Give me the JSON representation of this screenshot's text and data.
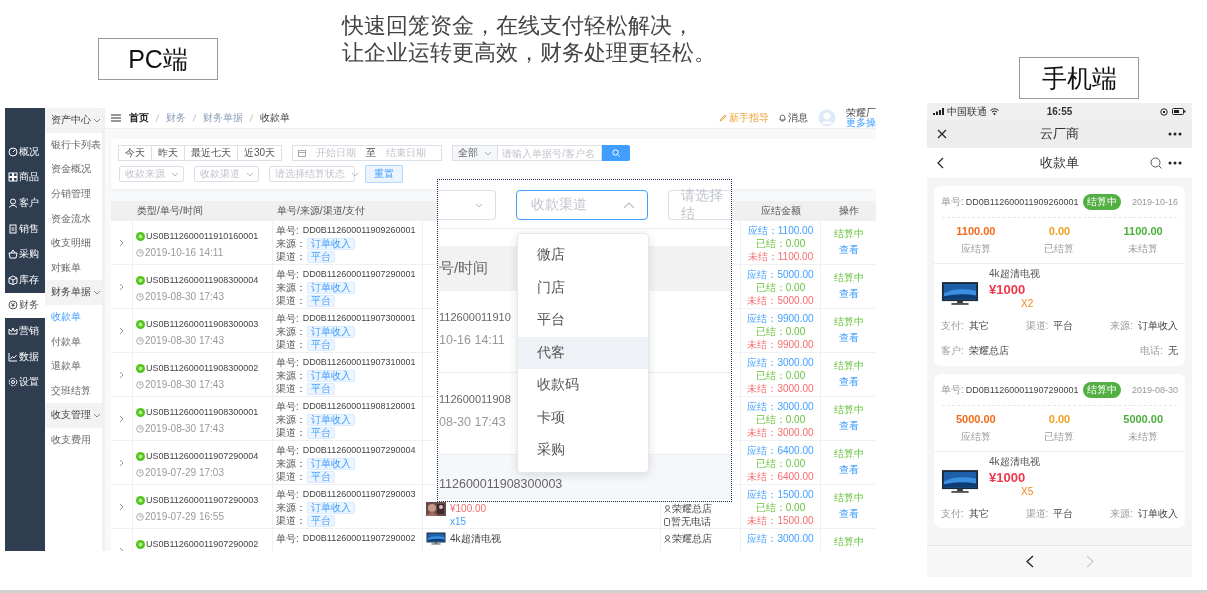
{
  "pc_label": "PC端",
  "headline": [
    "快速回笼资金，在线支付轻松解决，",
    "让企业运转更高效，财务处理更轻松。"
  ],
  "mobile_label": "手机端",
  "pc": {
    "sidebar": {
      "items": [
        {
          "label": "概况",
          "selected": false
        },
        {
          "label": "商品",
          "selected": false
        },
        {
          "label": "客户",
          "selected": false
        },
        {
          "label": "销售",
          "selected": false
        },
        {
          "label": "采购",
          "selected": false
        },
        {
          "label": "库存",
          "selected": false
        },
        {
          "label": "财务",
          "selected": true
        },
        {
          "label": "营销",
          "selected": false
        },
        {
          "label": "数据",
          "selected": false
        },
        {
          "label": "设置",
          "selected": false
        }
      ]
    },
    "subnav": {
      "items": [
        {
          "kind": "group",
          "label": "资产中心",
          "expanded": true
        },
        {
          "kind": "link",
          "label": "银行卡列表",
          "selected": false
        },
        {
          "kind": "link",
          "label": "资金概况",
          "selected": false
        },
        {
          "kind": "link",
          "label": "分销管理",
          "selected": false
        },
        {
          "kind": "link",
          "label": "资金流水",
          "selected": false
        },
        {
          "kind": "link",
          "label": "收支明细",
          "selected": false
        },
        {
          "kind": "link",
          "label": "对账单",
          "selected": false
        },
        {
          "kind": "group",
          "label": "财务单据",
          "expanded": true
        },
        {
          "kind": "link",
          "label": "收款单",
          "selected": true
        },
        {
          "kind": "link",
          "label": "付款单",
          "selected": false
        },
        {
          "kind": "link",
          "label": "退款单",
          "selected": false
        },
        {
          "kind": "link",
          "label": "交班结算",
          "selected": false
        },
        {
          "kind": "group",
          "label": "收支管理",
          "expanded": true
        },
        {
          "kind": "link",
          "label": "收支费用",
          "selected": false
        }
      ]
    },
    "topbar": {
      "breadcrumb": [
        "首页",
        "财务",
        "财务单据",
        "收款单"
      ],
      "guide": "新手指导",
      "messages": "消息",
      "user_name": "荣耀厂",
      "user_menu": "更多操"
    },
    "filters": {
      "date_buttons": [
        "今天",
        "昨天",
        "最近七天",
        "近30天"
      ],
      "start_placeholder": "开始日期",
      "range_separator": "至",
      "end_placeholder": "结束日期",
      "scope": "全部",
      "search_placeholder": "请输入单据号/客户名",
      "selects": [
        "收款来源",
        "收款渠道",
        "请选择结算状态"
      ],
      "reset": "重置"
    },
    "table": {
      "columns": [
        "类型/单号/时间",
        "单号/来源/渠道/支付",
        "应结金额",
        "操作"
      ],
      "rows": [
        {
          "type_id": "US0B112600011910160001",
          "time": "2019-10-16 14:11",
          "order_label": "单号:",
          "order_no": "DD0B112600011909260001",
          "source_label": "来源：",
          "source": "订单收入",
          "channel_label": "渠道：",
          "channel": "平台",
          "due": "应结：1100.00",
          "paid": "已结：0.00",
          "unpaid": "未结：1100.00",
          "status": "结算中",
          "action": "查看"
        },
        {
          "type_id": "US0B112600011908300004",
          "time": "2019-08-30 17:43",
          "order_label": "单号:",
          "order_no": "DD0B112600011907290001",
          "source_label": "来源：",
          "source": "订单收入",
          "channel_label": "渠道：",
          "channel": "平台",
          "due": "应结：5000.00",
          "paid": "已结：0.00",
          "unpaid": "未结：5000.00",
          "status": "结算中",
          "action": "查看"
        },
        {
          "type_id": "US0B112600011908300003",
          "time": "2019-08-30 17:43",
          "order_label": "单号:",
          "order_no": "DD0B112600011907300001",
          "source_label": "来源：",
          "source": "订单收入",
          "channel_label": "渠道：",
          "channel": "平台",
          "due": "应结：9900.00",
          "paid": "已结：0.00",
          "unpaid": "未结：9900.00",
          "status": "结算中",
          "action": "查看"
        },
        {
          "type_id": "US0B112600011908300002",
          "time": "2019-08-30 17:43",
          "order_label": "单号:",
          "order_no": "DD0B112600011907310001",
          "source_label": "来源：",
          "source": "订单收入",
          "channel_label": "渠道：",
          "channel": "平台",
          "due": "应结：3000.00",
          "paid": "已结：0.00",
          "unpaid": "未结：3000.00",
          "status": "结算中",
          "action": "查看"
        },
        {
          "type_id": "US0B112600011908300001",
          "time": "2019-08-30 17:43",
          "order_label": "单号:",
          "order_no": "DD0B112600011908120001",
          "source_label": "来源：",
          "source": "订单收入",
          "channel_label": "渠道：",
          "channel": "平台",
          "due": "应结：3000.00",
          "paid": "已结：0.00",
          "unpaid": "未结：3000.00",
          "status": "结算中",
          "action": "查看"
        },
        {
          "type_id": "US0B112600011907290004",
          "time": "2019-07-29 17:03",
          "order_label": "单号:",
          "order_no": "DD0B112600011907290004",
          "source_label": "来源：",
          "source": "订单收入",
          "channel_label": "渠道：",
          "channel": "平台",
          "due": "应结：6400.00",
          "paid": "已结：0.00",
          "unpaid": "未结：6400.00",
          "status": "结算中",
          "action": "查看"
        },
        {
          "type_id": "US0B112600011907290003",
          "time": "2019-07-29 16:55",
          "order_label": "单号:",
          "order_no": "DD0B112600011907290003",
          "source_label": "来源：",
          "source": "订单收入",
          "channel_label": "渠道：",
          "channel": "平台",
          "product": {
            "price": "¥100.00",
            "qty": "x15"
          },
          "customer": {
            "name": "荣耀总店",
            "phone": "暂无电话"
          },
          "due": "应结：1500.00",
          "paid": "已结：0.00",
          "unpaid": "未结：1500.00",
          "status": "结算中",
          "action": "查看"
        },
        {
          "type_id": "US0B112600011907290002",
          "order_label": "单号:",
          "order_no": "DD0B112600011907290002",
          "product": {
            "name": "4k超清电视"
          },
          "customer": {
            "name": "荣耀总店"
          },
          "due": "应结：3000.00",
          "status": "结算中"
        }
      ]
    },
    "zoom_inset": {
      "selects": [
        {
          "placeholder": "收款渠道",
          "open": true
        },
        {
          "placeholder": "请选择结",
          "open": false
        }
      ],
      "column": "号/时间",
      "rows": [
        {
          "id": "112600011910",
          "time": "10-16 14:11",
          "shaded": false
        },
        {
          "id": "112600011908",
          "time": "08-30 17:43",
          "shaded": false
        },
        {
          "id": "112600011908300003",
          "shaded": true
        }
      ],
      "menu": [
        {
          "label": "微店",
          "highlighted": false
        },
        {
          "label": "门店",
          "highlighted": false
        },
        {
          "label": "平台",
          "highlighted": false
        },
        {
          "label": "代客",
          "highlighted": true
        },
        {
          "label": "收款码",
          "highlighted": false
        },
        {
          "label": "卡项",
          "highlighted": false
        },
        {
          "label": "采购",
          "highlighted": false
        }
      ]
    }
  },
  "mobile": {
    "status_bar": {
      "carrier": "中国联通",
      "time": "16:55"
    },
    "app_title": "云厂商",
    "page_title": "收款单",
    "cards": [
      {
        "order_label": "单号:",
        "order_no": "DD0B112600011909260001",
        "status": "结算中",
        "date": "2019-10-16",
        "amounts": [
          {
            "value": "1100.00",
            "label": "应结算",
            "color": "#f26a1b"
          },
          {
            "value": "0.00",
            "label": "已结算",
            "color": "#f0a020"
          },
          {
            "value": "1100.00",
            "label": "未结算",
            "color": "#4caf3c"
          }
        ],
        "product": {
          "name": "4k超清电视",
          "price": "¥1000",
          "qty": "X2"
        },
        "details": [
          {
            "label": "支付:",
            "value": "其它"
          },
          {
            "label": "渠道:",
            "value": "平台"
          },
          {
            "label": "来源:",
            "value": "订单收入"
          }
        ],
        "footer": [
          {
            "label": "客户:",
            "value": "荣耀总店"
          },
          {
            "label": "电话:",
            "value": "无"
          }
        ]
      },
      {
        "order_label": "单号:",
        "order_no": "DD0B112600011907290001",
        "status": "结算中",
        "date": "2019-08-30",
        "amounts": [
          {
            "value": "5000.00",
            "label": "应结算",
            "color": "#f26a1b"
          },
          {
            "value": "0.00",
            "label": "已结算",
            "color": "#f0a020"
          },
          {
            "value": "5000.00",
            "label": "未结算",
            "color": "#4caf3c"
          }
        ],
        "product": {
          "name": "4k超清电视",
          "price": "¥1000",
          "qty": "X5"
        },
        "details": [
          {
            "label": "支付:",
            "value": "其它"
          },
          {
            "label": "渠道:",
            "value": "平台"
          },
          {
            "label": "来源:",
            "value": "订单收入"
          }
        ]
      }
    ],
    "pager": {
      "back_enabled": true,
      "forward_enabled": false
    }
  }
}
